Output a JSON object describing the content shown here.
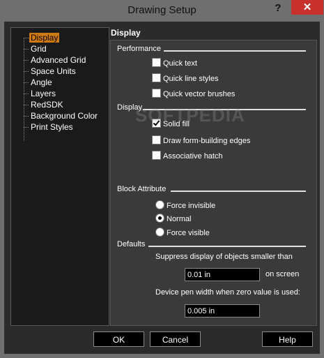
{
  "window": {
    "title": "Drawing Setup",
    "help_label": "?",
    "close_label": "✕"
  },
  "tree": {
    "items": [
      {
        "label": "Display",
        "selected": true
      },
      {
        "label": "Grid"
      },
      {
        "label": "Advanced Grid"
      },
      {
        "label": "Space Units"
      },
      {
        "label": "Angle"
      },
      {
        "label": "Layers"
      },
      {
        "label": "RedSDK"
      },
      {
        "label": "Background Color"
      },
      {
        "label": "Print Styles"
      }
    ]
  },
  "panel": {
    "header": "Display",
    "performance": {
      "label": "Performance",
      "quick_text": {
        "label": "Quick text",
        "checked": false
      },
      "quick_line_styles": {
        "label": "Quick line styles",
        "checked": false
      },
      "quick_vector_brushes": {
        "label": "Quick vector brushes",
        "checked": false
      }
    },
    "display": {
      "label": "Display",
      "solid_fill": {
        "label": "Solid fill",
        "checked": true
      },
      "draw_form_building_edges": {
        "label": "Draw form-building edges",
        "checked": false
      },
      "associative_hatch": {
        "label": "Associative hatch",
        "checked": false
      }
    },
    "block_attribute": {
      "label": "Block Attribute",
      "force_invisible": {
        "label": "Force invisible",
        "selected": false
      },
      "normal": {
        "label": "Normal",
        "selected": true
      },
      "force_visible": {
        "label": "Force visible",
        "selected": false
      }
    },
    "defaults": {
      "label": "Defaults",
      "suppress_label": "Suppress display of objects smaller than",
      "suppress_value": "0.01 in",
      "suppress_unit": "on screen",
      "pen_width_label": "Device pen width when zero value is used:",
      "pen_width_value": "0.005 in"
    }
  },
  "watermark": "SOFTPEDIA",
  "buttons": {
    "ok": "OK",
    "cancel": "Cancel",
    "help": "Help"
  },
  "colors": {
    "selection": "#d07a14",
    "close_button": "#c7302b",
    "background": "#2b2b2b"
  }
}
